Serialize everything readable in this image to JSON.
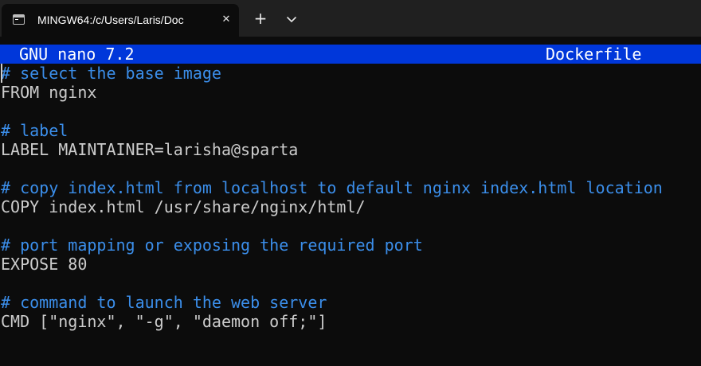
{
  "tab": {
    "title": "MINGW64:/c/Users/Laris/Doc",
    "close_glyph": "✕",
    "icon": "terminal-icon"
  },
  "tabbar": {
    "new_tab_glyph": "+",
    "new_tab_icon": "plus-icon",
    "dropdown_icon": "chevron-down-icon"
  },
  "nano": {
    "version": "GNU nano 7.2",
    "filename": "Dockerfile",
    "header_color": "#0037da"
  },
  "colors": {
    "comment": "#3b8eea",
    "text": "#cccccc",
    "background": "#0c0c0c"
  },
  "editor": {
    "lines": [
      {
        "text": "# select the base image",
        "type": "comment"
      },
      {
        "text": "FROM nginx",
        "type": "code"
      },
      {
        "text": "",
        "type": "blank"
      },
      {
        "text": "# label",
        "type": "comment"
      },
      {
        "text": "LABEL MAINTAINER=larisha@sparta",
        "type": "code"
      },
      {
        "text": "",
        "type": "blank"
      },
      {
        "text": "# copy index.html from localhost to default nginx index.html location",
        "type": "comment"
      },
      {
        "text": "COPY index.html /usr/share/nginx/html/",
        "type": "code"
      },
      {
        "text": "",
        "type": "blank"
      },
      {
        "text": "# port mapping or exposing the required port",
        "type": "comment"
      },
      {
        "text": "EXPOSE 80",
        "type": "code"
      },
      {
        "text": "",
        "type": "blank"
      },
      {
        "text": "# command to launch the web server",
        "type": "comment"
      },
      {
        "text": "CMD [\"nginx\", \"-g\", \"daemon off;\"]",
        "type": "code"
      }
    ]
  }
}
